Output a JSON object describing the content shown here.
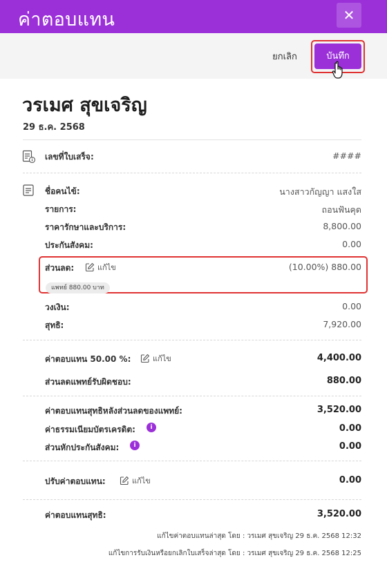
{
  "header": {
    "title": "ค่าตอบแทน",
    "close_label": "✕"
  },
  "toolbar": {
    "cancel_label": "ยกเลิก",
    "save_label": "บันทึก"
  },
  "patient": {
    "name": "วรเมศ สุขเจริญ",
    "date": "29 ธ.ค. 2568"
  },
  "receipt": {
    "label": "เลขที่ใบเสร็จ:",
    "value": "####"
  },
  "details": {
    "patient_name_label": "ชื่อคนไข้:",
    "patient_name_value": "นางสาวกัญญา แสงใส",
    "item_label": "รายการ:",
    "item_value": "ถอนฟันคุด",
    "treatment_label": "ราคารักษาและบริการ:",
    "treatment_value": "8,800.00",
    "social_security_label": "ประกันสังคม:",
    "social_security_value": "0.00",
    "discount_label": "ส่วนลด:",
    "discount_edit": "แก้ไข",
    "discount_value": "(10.00%) 880.00",
    "discount_pill": "แพทย์ 880.00 บาท",
    "credit_label": "วงเงิน:",
    "credit_value": "0.00",
    "net_label": "สุทธิ:",
    "net_value": "7,920.00"
  },
  "compensation": {
    "rate_label": "ค่าตอบแทน 50.00 %:",
    "rate_edit": "แก้ไข",
    "rate_value": "4,400.00",
    "doctor_discount_label": "ส่วนลดแพทย์รับผิดชอบ:",
    "doctor_discount_value": "880.00",
    "net_after_label": "ค่าตอบแทนสุทธิหลังส่วนลดของแพทย์:",
    "net_after_value": "3,520.00",
    "card_fee_label": "ค่าธรรมเนียมบัตรเครดิต:",
    "card_fee_value": "0.00",
    "ss_deduction_label": "ส่วนหักประกันสังคม:",
    "ss_deduction_value": "0.00",
    "adjust_label": "ปรับค่าตอบแทน:",
    "adjust_edit": "แก้ไข",
    "adjust_value": "0.00",
    "final_label": "ค่าตอบแทนสุทธิ:",
    "final_value": "3,520.00"
  },
  "footer": {
    "line1": "แก้ไขค่าตอบแทนล่าสุด โดย : วรเมศ สุขเจริญ 29 ธ.ค. 2568 12:32",
    "line2": "แก้ไขการรับเงินหรือยกเลิกใบเสร็จล่าสุด โดย : วรเมศ สุขเจริญ 29 ธ.ค. 2568 12:25"
  },
  "icons": {
    "info_glyph": "i"
  },
  "colors": {
    "brand": "#9b30d9",
    "highlight": "#e03131"
  }
}
